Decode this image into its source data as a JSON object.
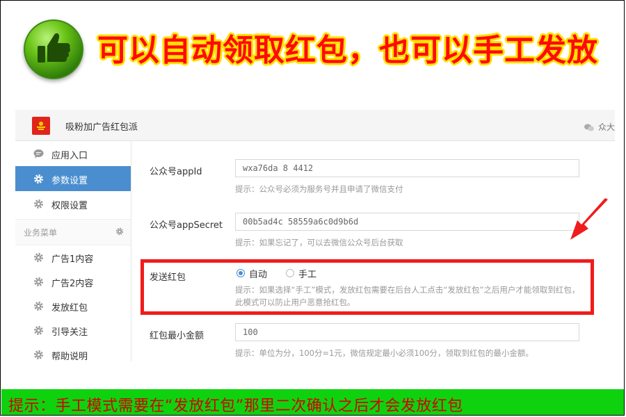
{
  "banner": {
    "headline": "可以自动领取红包，也可以手工发放",
    "headline_color": "#ff0a0a",
    "outline_color": "#ffe000",
    "badge_icon": "thumbs-up-icon"
  },
  "app": {
    "title": "吸粉加广告红包派",
    "top_right_label": "众大",
    "top_right_icon": "wechat-icon"
  },
  "sidebar": {
    "items": [
      {
        "label": "应用入口",
        "icon": "chat-bubble-icon"
      },
      {
        "label": "参数设置",
        "icon": "gear-icon",
        "active": true
      },
      {
        "label": "权限设置",
        "icon": "gear-icon"
      }
    ],
    "section_label": "业务菜单",
    "sub_items": [
      {
        "label": "广告1内容",
        "icon": "gear-icon"
      },
      {
        "label": "广告2内容",
        "icon": "gear-icon"
      },
      {
        "label": "发放红包",
        "icon": "gear-icon"
      },
      {
        "label": "引导关注",
        "icon": "gear-icon"
      },
      {
        "label": "帮助说明",
        "icon": "gear-icon"
      }
    ],
    "active_color": "#4a8ecf"
  },
  "form": {
    "appid_label": "公众号appId",
    "appid_value": "wxa76da  8  4412",
    "appid_hint": "提示：公众号必须为服务号并且申请了微信支付",
    "secret_label": "公众号appSecret",
    "secret_value": "00b5ad4c    58559a6c0d9b6d",
    "secret_hint": "提示：如果忘记了，可以去微信公众号后台获取",
    "send_label": "发送红包",
    "radio_auto": "自动",
    "radio_manual": "手工",
    "send_hint": "提示：如果选择“手工”模式，发放红包需要在后台人工点击“发放红包”之后用户才能领取到红包，此模式可以防止用户恶意抢红包。",
    "min_label": "红包最小金额",
    "min_value": "100",
    "min_hint": "提示：单位为分，100分=1元，微信规定最小必须100分，领取到红包的最小金额。"
  },
  "footer": {
    "text": "提示：手工模式需要在“发放红包”那里二次确认之后才会发放红包",
    "bg_color": "#0fd20f",
    "text_color": "#d40000"
  },
  "highlight_color": "#f01c1c"
}
